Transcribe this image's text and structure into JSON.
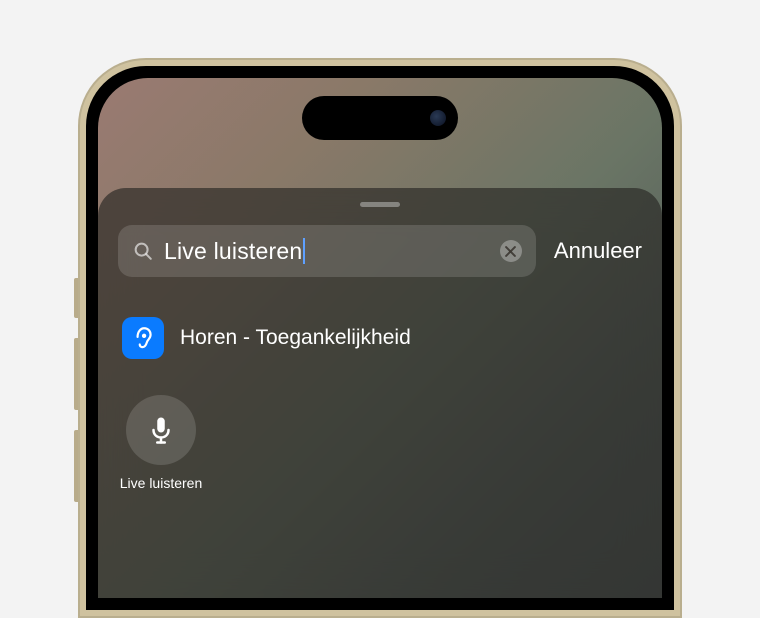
{
  "search": {
    "query": "Live luisteren",
    "cancel": "Annuleer"
  },
  "result": {
    "label": "Horen - Toegankelijkheid"
  },
  "tile": {
    "label": "Live luisteren"
  }
}
